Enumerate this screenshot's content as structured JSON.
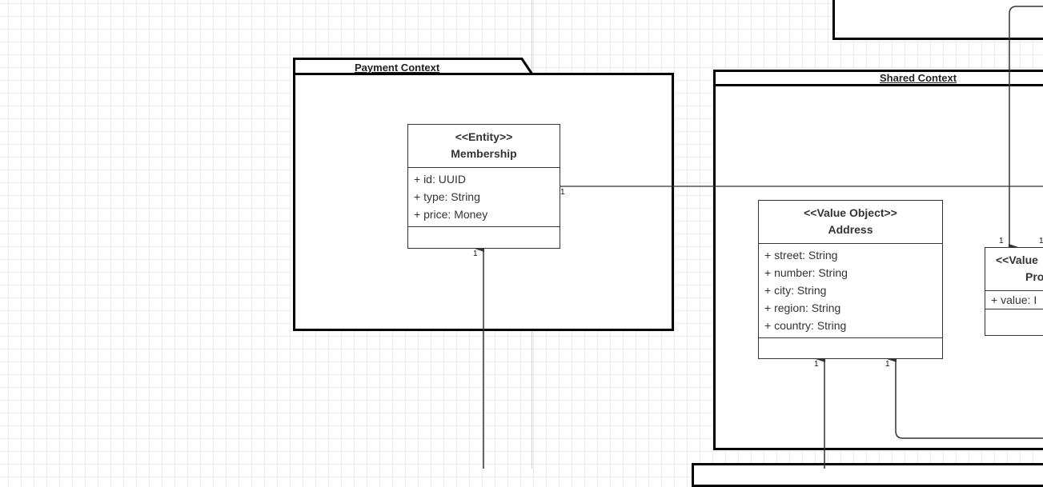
{
  "packages": {
    "payment": {
      "title": "Payment Context"
    },
    "shared": {
      "title": "Shared Context"
    }
  },
  "classes": {
    "membership": {
      "stereotype": "<<Entity>>",
      "name": "Membership",
      "attributes": [
        "+ id: UUID",
        "+ type: String",
        "+ price: Money"
      ]
    },
    "address": {
      "stereotype": "<<Value Object>>",
      "name": "Address",
      "attributes": [
        "+ street: String",
        "+ number: String",
        "+ city: String",
        "+ region: String",
        "+ country: String"
      ]
    },
    "partial_value_object": {
      "stereotype": "<<Value",
      "name": "Pro",
      "attributes": [
        "+ value: I"
      ]
    }
  },
  "multiplicities": {
    "membership_bottom": "1",
    "membership_right": "1",
    "address_left": "1",
    "address_right": "1",
    "vo_left": "1",
    "vo_right": "1"
  },
  "colors": {
    "grid": "#ececec",
    "stroke": "#000000",
    "connector": "#333333"
  }
}
